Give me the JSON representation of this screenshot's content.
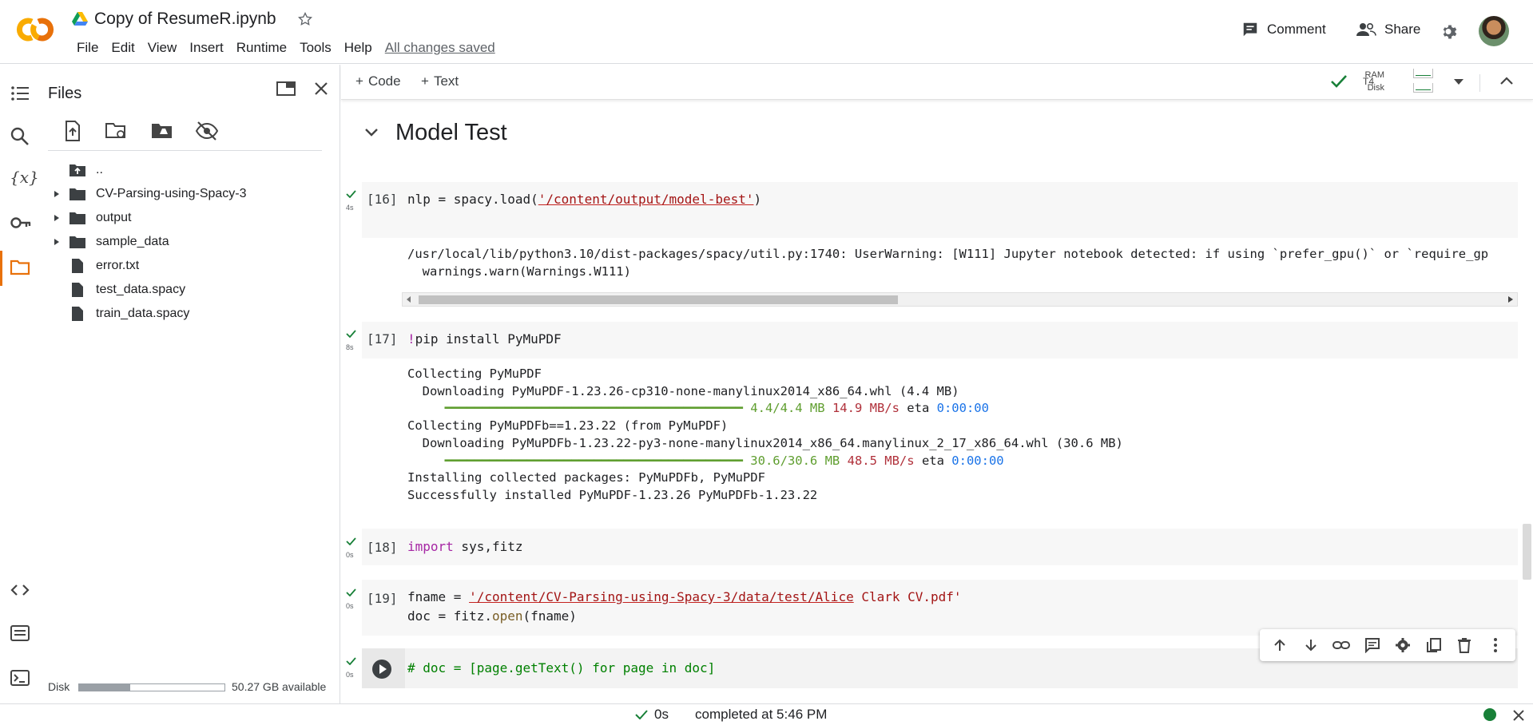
{
  "header": {
    "doc_title": "Copy of ResumeR.ipynb",
    "menu": [
      "File",
      "Edit",
      "View",
      "Insert",
      "Runtime",
      "Tools",
      "Help"
    ],
    "saved_status": "All changes saved",
    "comment_label": "Comment",
    "share_label": "Share"
  },
  "toolbar": {
    "add_code": "Code",
    "add_text": "Text",
    "runtime_type": "T4",
    "ram_label": "RAM",
    "disk_label": "Disk"
  },
  "files_panel": {
    "title": "Files",
    "tree": [
      {
        "name": "..",
        "type": "parent"
      },
      {
        "name": "CV-Parsing-using-Spacy-3",
        "type": "folder"
      },
      {
        "name": "output",
        "type": "folder"
      },
      {
        "name": "sample_data",
        "type": "folder"
      },
      {
        "name": "error.txt",
        "type": "file"
      },
      {
        "name": "test_data.spacy",
        "type": "file"
      },
      {
        "name": "train_data.spacy",
        "type": "file"
      }
    ],
    "disk_label": "Disk",
    "disk_used_fraction": 0.35,
    "disk_available": "50.27 GB available"
  },
  "notebook": {
    "section_title": "Model Test",
    "cells": [
      {
        "exec": "[16]",
        "time": "4s"
      },
      {
        "exec": "[17]",
        "time": "8s"
      },
      {
        "exec": "[18]",
        "time": "0s"
      },
      {
        "exec": "[19]",
        "time": "0s"
      },
      {
        "exec": "",
        "time": "0s"
      }
    ],
    "code16": {
      "pre": "nlp = spacy.load(",
      "str": "'/content/output/model-best'",
      "post": ")"
    },
    "out16": [
      "/usr/local/lib/python3.10/dist-packages/spacy/util.py:1740: UserWarning: [W111] Jupyter notebook detected: if using `prefer_gpu()` or `require_gp",
      "  warnings.warn(Warnings.W111)"
    ],
    "code17": {
      "bang": "!",
      "rest": "pip install PyMuPDF"
    },
    "out17": {
      "l1": "Collecting PyMuPDF",
      "l2": "  Downloading PyMuPDF-1.23.26-cp310-none-manylinux2014_x86_64.whl (4.4 MB)",
      "l3_bar": "     ━━━━━━━━━━━━━━━━━━━━━━━━━━━━━━━━━━━━━━━━",
      "l3_size": "4.4/4.4 MB",
      "l3_speed": "14.9 MB/s",
      "l3_eta": "eta",
      "l3_time": "0:00:00",
      "l4": "Collecting PyMuPDFb==1.23.22 (from PyMuPDF)",
      "l5": "  Downloading PyMuPDFb-1.23.22-py3-none-manylinux2014_x86_64.manylinux_2_17_x86_64.whl (30.6 MB)",
      "l6_bar": "     ━━━━━━━━━━━━━━━━━━━━━━━━━━━━━━━━━━━━━━━━",
      "l6_size": "30.6/30.6 MB",
      "l6_speed": "48.5 MB/s",
      "l6_eta": "eta",
      "l6_time": "0:00:00",
      "l7": "Installing collected packages: PyMuPDFb, PyMuPDF",
      "l8": "Successfully installed PyMuPDF-1.23.26 PyMuPDFb-1.23.22"
    },
    "code18": {
      "kw": "import",
      "rest": " sys,fitz"
    },
    "code19": {
      "l1_pre": "fname = ",
      "l1_str": "'/content/CV-Parsing-using-Spacy-3/data/test/Alice",
      "l1_post": " Clark CV.pdf'",
      "l2_pre": "doc = fitz.",
      "l2_fn": "open",
      "l2_post": "(fname)"
    },
    "code20": "# doc = [page.getText() for page in doc]"
  },
  "status": {
    "duration": "0s",
    "completed": "completed at 5:46 PM"
  }
}
